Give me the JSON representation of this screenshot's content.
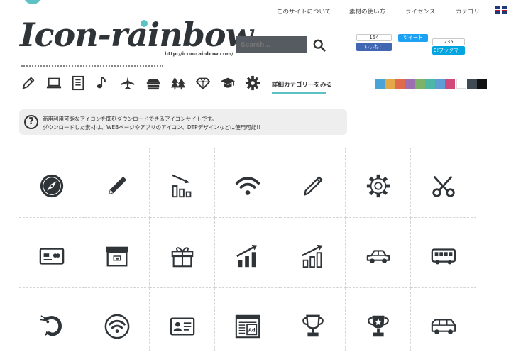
{
  "nav": {
    "about": "このサイトについて",
    "usage": "素材の使い方",
    "license": "ライセンス",
    "category": "カテゴリー",
    "lang_icon": "uk-flag-icon"
  },
  "logo": {
    "text": "Icon-rainbow",
    "url": "http://icon-rainbow.com/"
  },
  "search": {
    "placeholder": "Search..."
  },
  "social": {
    "fb_count": "154",
    "fb_label": "いいね！",
    "tw_label": "ツイート",
    "hb_count": "235",
    "hb_label": "B!ブックマーク"
  },
  "categories": {
    "icons": [
      "pencil-icon",
      "laptop-icon",
      "document-icon",
      "music-note-icon",
      "airplane-icon",
      "hamburger-icon",
      "trees-icon",
      "diamond-icon",
      "graduation-cap-icon",
      "gear-icon"
    ],
    "more_label": "詳細カテゴリーをみる"
  },
  "color_filters": [
    "#4aa3d8",
    "#e3a847",
    "#e06a4e",
    "#9c6fb0",
    "#7cb26a",
    "#4db6a6",
    "#5d9cd4",
    "#d1487a",
    "#ffffff",
    "#3e4a54",
    "#111111"
  ],
  "info": {
    "line1": "商用利用可能なアイコンを即刻ダウンロードできるアイコンサイトです。",
    "line2": "ダウンロードした素材は、WEBページやアプリのアイコン、DTPデザインなどに使用可能!!"
  },
  "grid": [
    [
      "compass-icon",
      "pencil-icon",
      "bar-chart-down-icon",
      "wifi-icon",
      "pen-icon",
      "gear-icon",
      "scissors-icon"
    ],
    [
      "credit-card-icon",
      "box-icon",
      "gift-icon",
      "bar-chart-up-icon",
      "bar-chart-up-outline-icon",
      "car-icon",
      "bus-icon"
    ],
    [
      "shrimp-icon",
      "wifi-circle-icon",
      "id-card-icon",
      "ad-browser-icon",
      "trophy-outline-icon",
      "trophy-icon",
      "van-icon"
    ]
  ]
}
